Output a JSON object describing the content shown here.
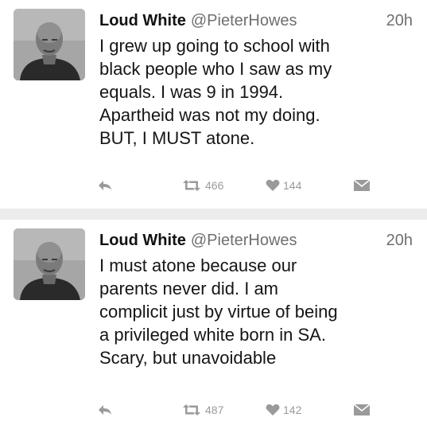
{
  "tweets": [
    {
      "name": "Loud White",
      "handle": "@PieterHowes",
      "time": "20h",
      "text_lines": [
        "I grew up going to school with",
        "black people who I saw as my",
        "equals. I was 9 in 1994.",
        "Apartheid was not my doing.",
        "BUT, I MUST atone."
      ],
      "retweets": "466",
      "likes": "144"
    },
    {
      "name": "Loud White",
      "handle": "@PieterHowes",
      "time": "20h",
      "text_lines": [
        "I must atone because our",
        "parents never did. I am",
        "complicit just by virtue of being",
        "a privileged white born in SA.",
        "Scary, but unavoidable"
      ],
      "retweets": "487",
      "likes": "142"
    }
  ],
  "icons": {
    "avatar": "profile-photo",
    "reply": "reply-icon",
    "retweet": "retweet-icon",
    "like": "heart-icon",
    "message": "envelope-icon"
  }
}
